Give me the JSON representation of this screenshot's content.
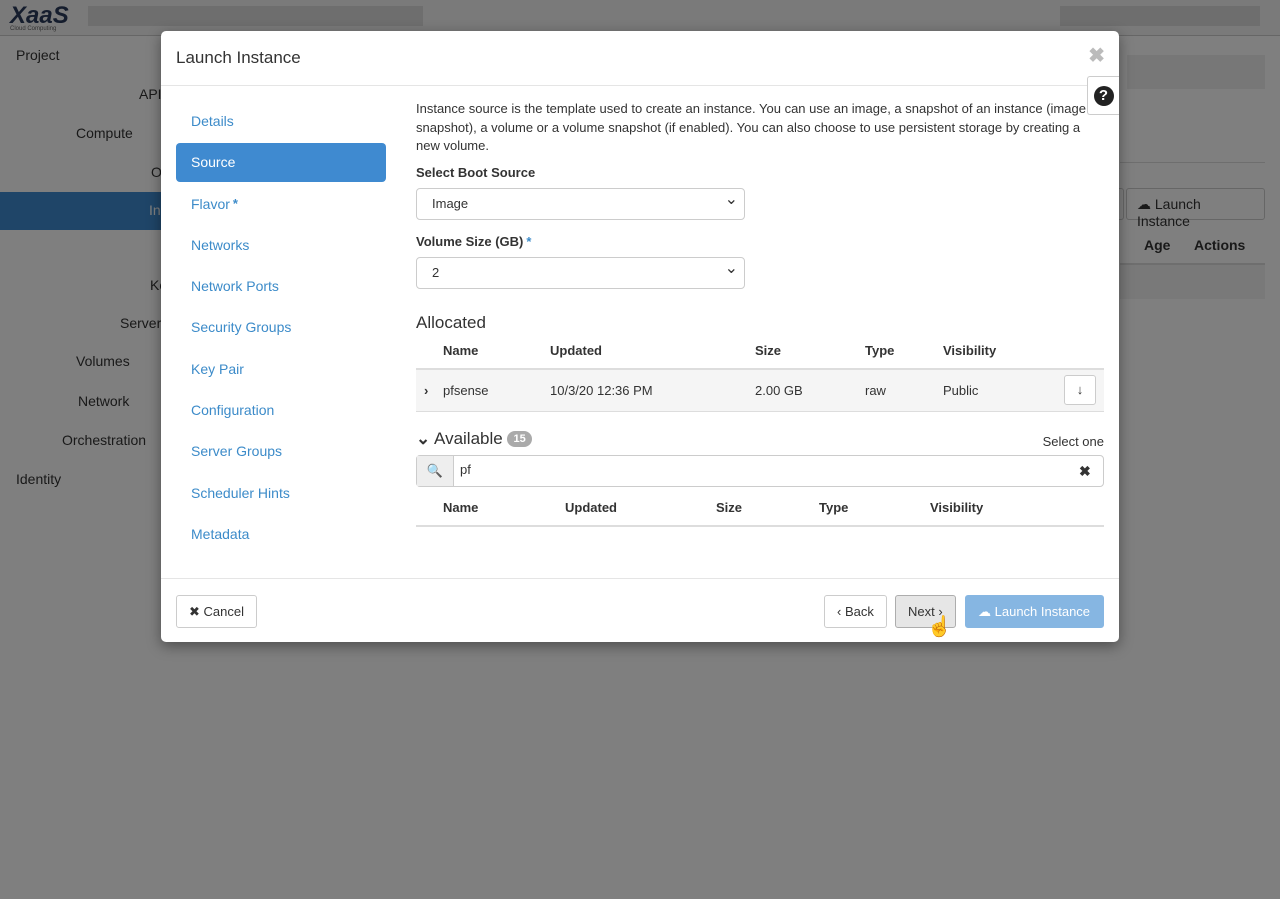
{
  "background": {
    "logo": "XaaS",
    "logo_sub": "Cloud Computing",
    "sidebar": [
      "Project",
      "API",
      "Compute",
      "O",
      "In",
      "Ke",
      "Server",
      "Volumes",
      "Network",
      "Orchestration",
      "Identity"
    ],
    "launch_button": "Launch Instance",
    "columns": [
      "Age",
      "Actions"
    ]
  },
  "modal": {
    "title": "Launch Instance",
    "nav": [
      {
        "label": "Details"
      },
      {
        "label": "Source",
        "active": true
      },
      {
        "label": "Flavor",
        "required": "*"
      },
      {
        "label": "Networks"
      },
      {
        "label": "Network Ports"
      },
      {
        "label": "Security Groups"
      },
      {
        "label": "Key Pair"
      },
      {
        "label": "Configuration"
      },
      {
        "label": "Server Groups"
      },
      {
        "label": "Scheduler Hints"
      },
      {
        "label": "Metadata"
      }
    ],
    "description": "Instance source is the template used to create an instance. You can use an image, a snapshot of an instance (image snapshot), a volume or a volume snapshot (if enabled). You can also choose to use persistent storage by creating a new volume.",
    "boot_source_label": "Select Boot Source",
    "boot_source_value": "Image",
    "volume_size_label": "Volume Size (GB)",
    "volume_size_required": "*",
    "volume_size_value": "2",
    "allocated": {
      "title": "Allocated",
      "columns": [
        "Name",
        "Updated",
        "Size",
        "Type",
        "Visibility"
      ],
      "rows": [
        {
          "name": "pfsense",
          "updated": "10/3/20 12:36 PM",
          "size": "2.00 GB",
          "type": "raw",
          "visibility": "Public"
        }
      ]
    },
    "available": {
      "title": "Available",
      "count": "15",
      "select_hint": "Select one",
      "search_value": "pf",
      "columns": [
        "Name",
        "Updated",
        "Size",
        "Type",
        "Visibility"
      ]
    },
    "footer": {
      "cancel": "Cancel",
      "back": "Back",
      "next": "Next",
      "launch": "Launch Instance"
    },
    "accent": "#3f8ad0"
  }
}
